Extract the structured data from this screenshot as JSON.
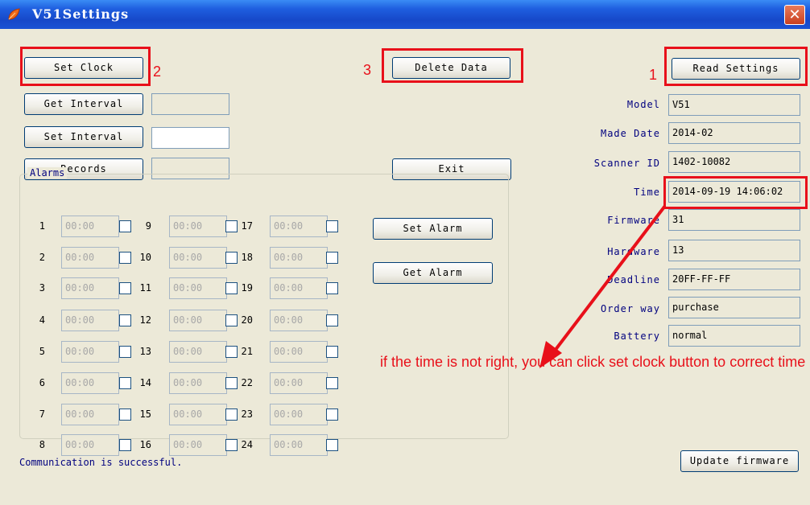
{
  "window": {
    "title": "V51Settings",
    "close_glyph": "✕"
  },
  "buttons": {
    "set_clock": "Set Clock",
    "get_interval": "Get Interval",
    "set_interval": "Set Interval",
    "records": "Records",
    "delete_data": "Delete Data",
    "exit": "Exit",
    "read_settings": "Read Settings",
    "set_alarm": "Set Alarm",
    "get_alarm": "Get Alarm",
    "update_firmware": "Update firmware"
  },
  "fields": {
    "get_interval_value": "",
    "set_interval_value": "",
    "records_value": ""
  },
  "info": [
    {
      "label": "Model",
      "value": "V51"
    },
    {
      "label": "Made Date",
      "value": "2014-02"
    },
    {
      "label": "Scanner ID",
      "value": "1402-10082"
    },
    {
      "label": "Time",
      "value": "2014-09-19 14:06:02"
    },
    {
      "label": "Firmware",
      "value": "31"
    },
    {
      "label": "Hardware",
      "value": "13"
    },
    {
      "label": "Deadline",
      "value": "20FF-FF-FF"
    },
    {
      "label": "Order way",
      "value": "purchase"
    },
    {
      "label": "Battery",
      "value": "normal"
    }
  ],
  "alarms": {
    "legend": "Alarms",
    "items": [
      {
        "num": "1",
        "time": "00:00"
      },
      {
        "num": "2",
        "time": "00:00"
      },
      {
        "num": "3",
        "time": "00:00"
      },
      {
        "num": "4",
        "time": "00:00"
      },
      {
        "num": "5",
        "time": "00:00"
      },
      {
        "num": "6",
        "time": "00:00"
      },
      {
        "num": "7",
        "time": "00:00"
      },
      {
        "num": "8",
        "time": "00:00"
      },
      {
        "num": "9",
        "time": "00:00"
      },
      {
        "num": "10",
        "time": "00:00"
      },
      {
        "num": "11",
        "time": "00:00"
      },
      {
        "num": "12",
        "time": "00:00"
      },
      {
        "num": "13",
        "time": "00:00"
      },
      {
        "num": "14",
        "time": "00:00"
      },
      {
        "num": "15",
        "time": "00:00"
      },
      {
        "num": "16",
        "time": "00:00"
      },
      {
        "num": "17",
        "time": "00:00"
      },
      {
        "num": "18",
        "time": "00:00"
      },
      {
        "num": "19",
        "time": "00:00"
      },
      {
        "num": "20",
        "time": "00:00"
      },
      {
        "num": "21",
        "time": "00:00"
      },
      {
        "num": "22",
        "time": "00:00"
      },
      {
        "num": "23",
        "time": "00:00"
      },
      {
        "num": "24",
        "time": "00:00"
      }
    ]
  },
  "status_text": "Communication is successful.",
  "annotations": {
    "step1": "1",
    "step2": "2",
    "step3": "3",
    "note": "if the time is not right, you can click set clock button to correct time",
    "color": "#e8101a"
  },
  "colors": {
    "titlebar": "#1f5fe0",
    "window_bg": "#ece9d8",
    "label_blue": "#00007f"
  },
  "icons": {
    "app": "leaf-app-icon",
    "close": "close-icon"
  }
}
